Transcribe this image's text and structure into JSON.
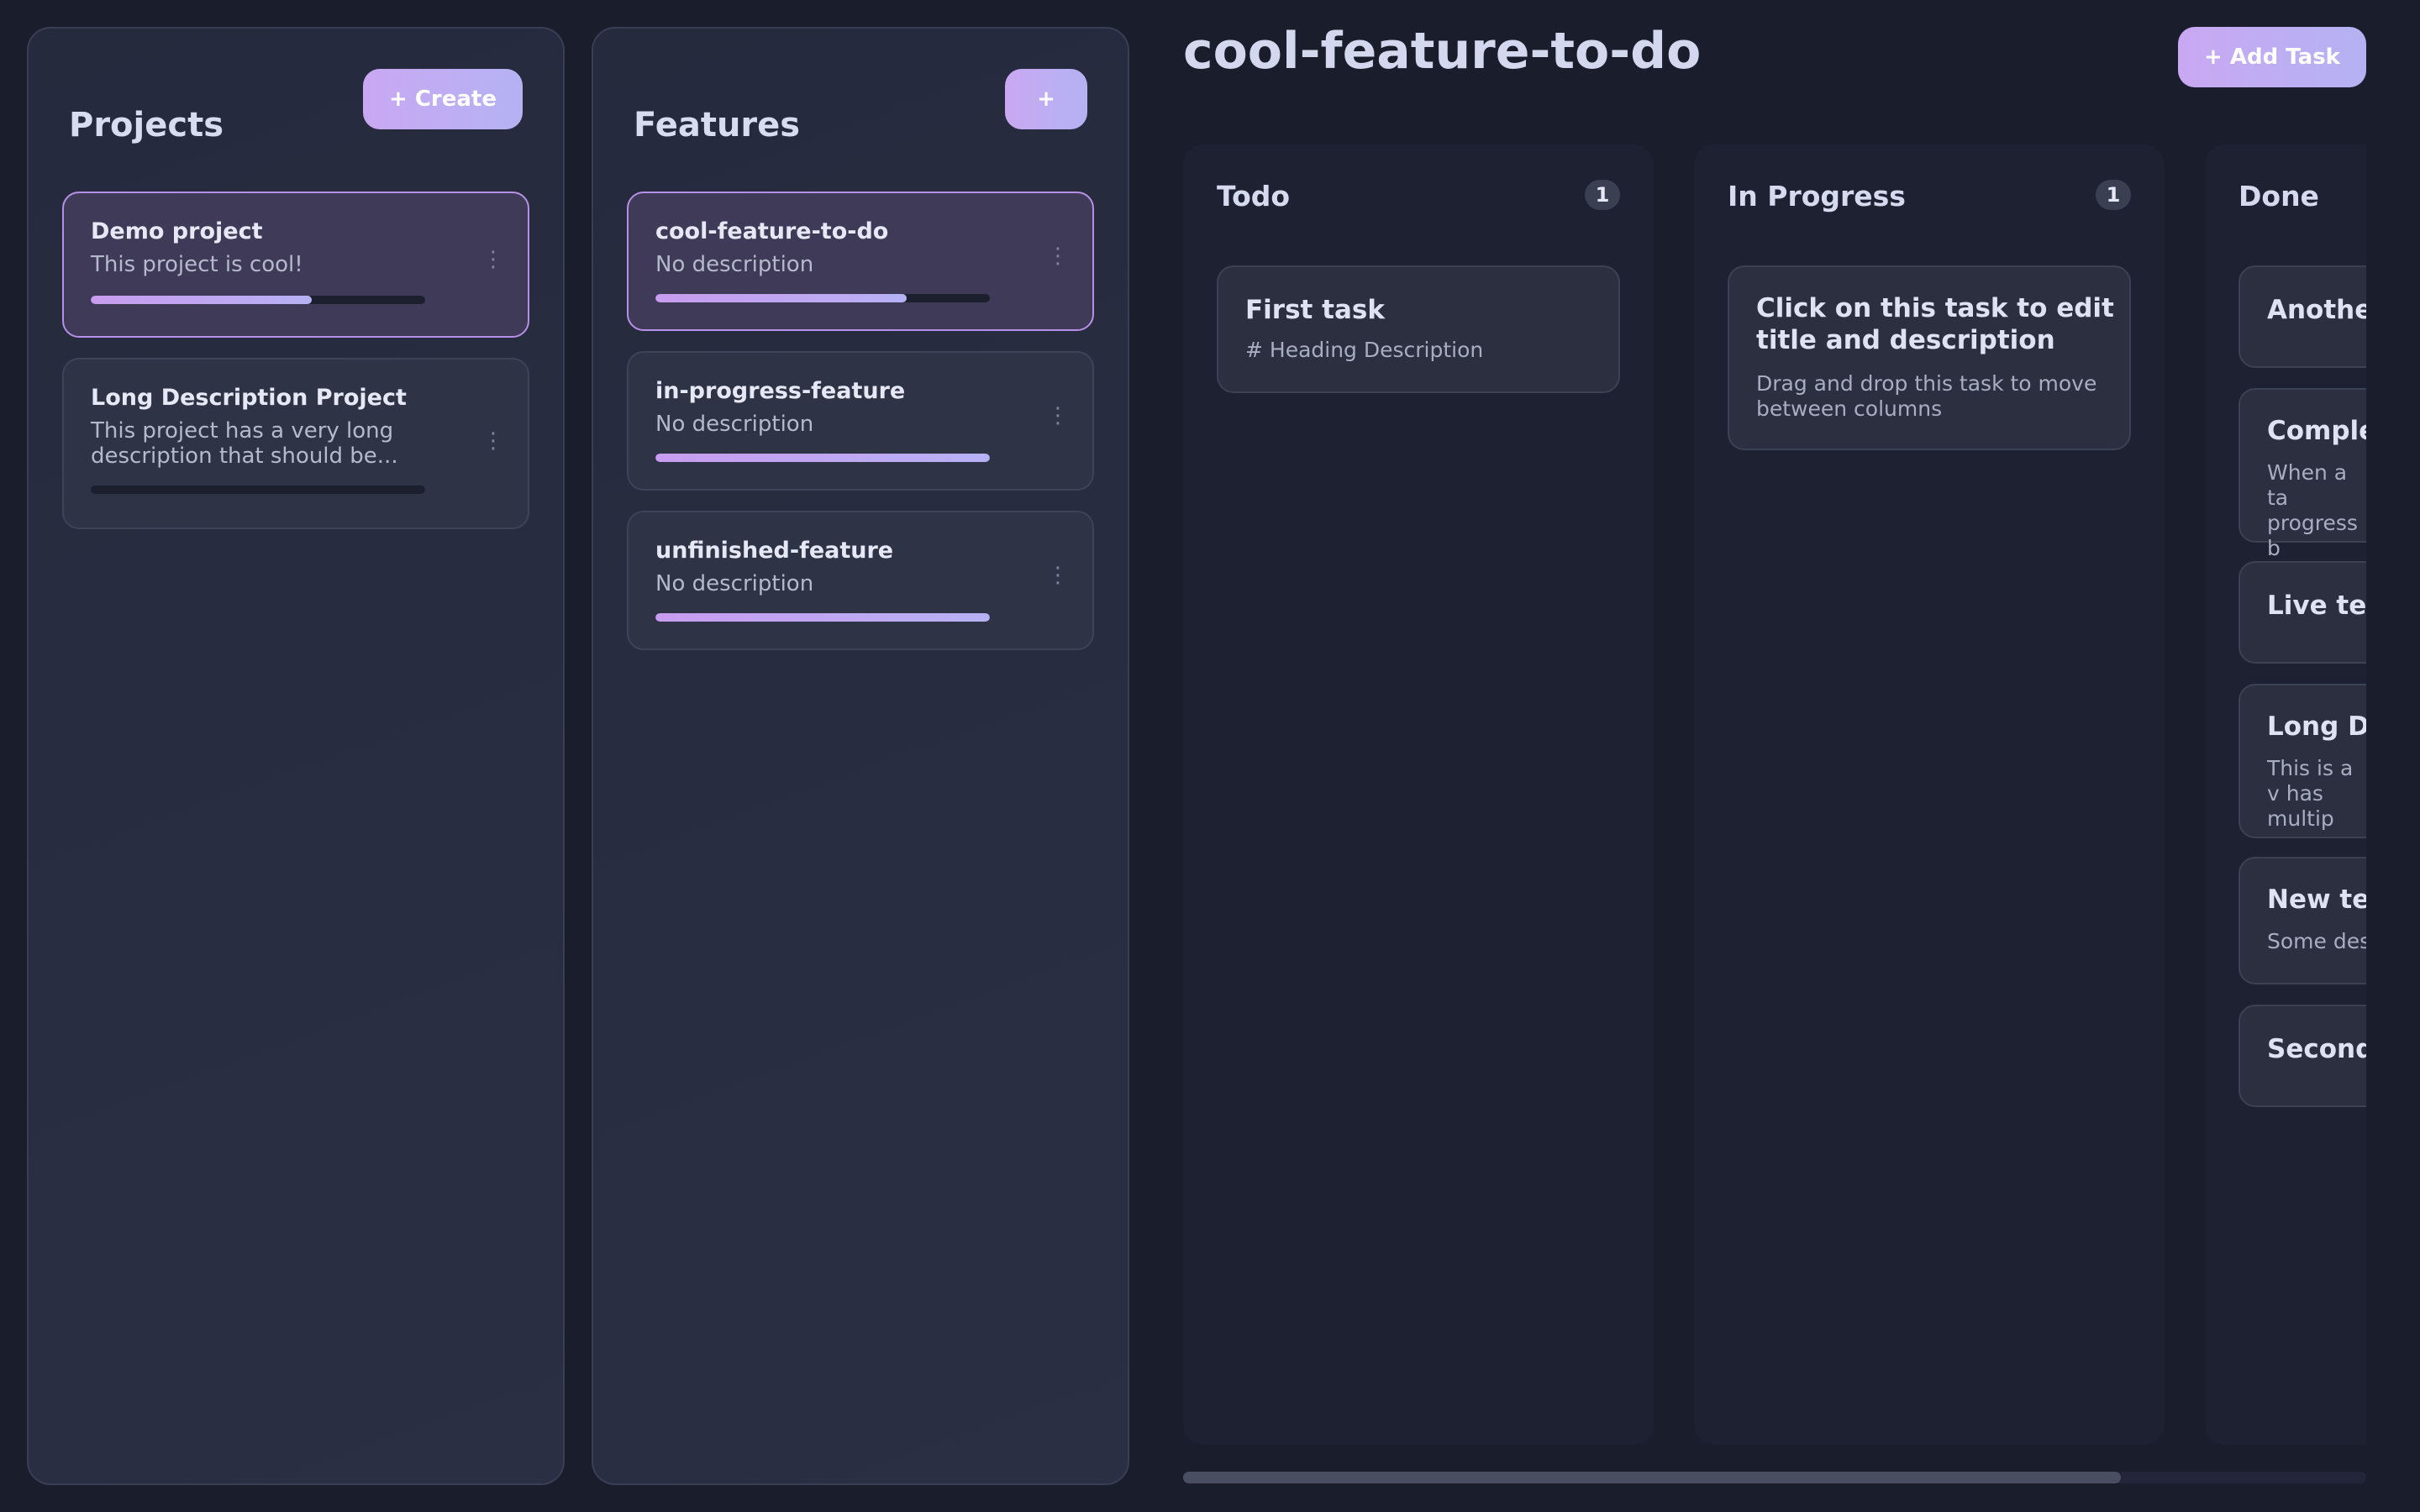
{
  "projects_panel": {
    "title": "Projects",
    "create_label": "+ Create",
    "items": [
      {
        "title": "Demo project",
        "description": "This project is cool!",
        "progress": 0.66,
        "selected": true
      },
      {
        "title": "Long Description Project",
        "description": "This project has a very long description that should be...",
        "progress": 0,
        "selected": false
      }
    ]
  },
  "features_panel": {
    "title": "Features",
    "add_label": "+",
    "items": [
      {
        "title": "cool-feature-to-do",
        "description": "No description",
        "progress": 0.75,
        "selected": true
      },
      {
        "title": "in-progress-feature",
        "description": "No description",
        "progress": 1.0,
        "selected": false
      },
      {
        "title": "unfinished-feature",
        "description": "No description",
        "progress": 1.0,
        "selected": false
      }
    ]
  },
  "board": {
    "title": "cool-feature-to-do",
    "add_task_label": "+ Add Task",
    "columns": [
      {
        "title": "Todo",
        "count": "1",
        "tasks": [
          {
            "title": "First task",
            "description": "# Heading Description"
          }
        ]
      },
      {
        "title": "In Progress",
        "count": "1",
        "tasks": [
          {
            "title": "Click on this task to edit title and description",
            "description": "Drag and drop this task to move between columns"
          }
        ]
      },
      {
        "title": "Done",
        "tasks": [
          {
            "title": "Another",
            "description": ""
          },
          {
            "title": "Complet",
            "description": "When a ta progress b"
          },
          {
            "title": "Live test",
            "description": ""
          },
          {
            "title": "Long De",
            "description": "This is a v has multip"
          },
          {
            "title": "New tes",
            "description": "Some des"
          },
          {
            "title": "Second",
            "description": ""
          }
        ]
      }
    ]
  },
  "icons": {
    "kebab": "kebab-menu-icon"
  },
  "colors": {
    "accent": "#c9a8f2",
    "background": "#1a1d2c",
    "selected_border": "#b68fe6"
  }
}
